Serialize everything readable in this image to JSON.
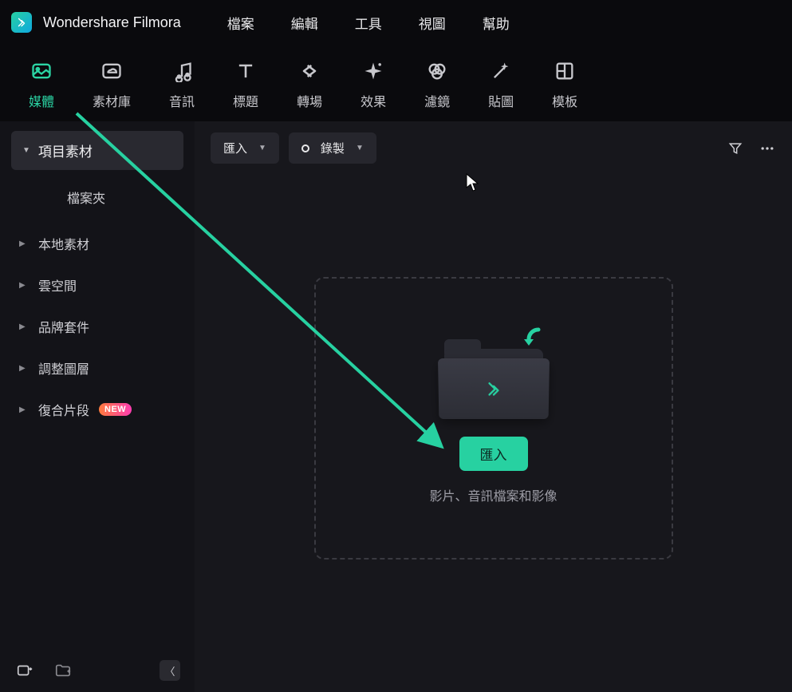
{
  "app": {
    "title": "Wondershare Filmora"
  },
  "menubar": {
    "items": [
      "檔案",
      "編輯",
      "工具",
      "視圖",
      "幫助"
    ]
  },
  "ribbon": {
    "items": [
      {
        "label": "媒體",
        "icon": "media",
        "active": true
      },
      {
        "label": "素材庫",
        "icon": "stock",
        "active": false
      },
      {
        "label": "音訊",
        "icon": "audio",
        "active": false
      },
      {
        "label": "標題",
        "icon": "titles",
        "active": false
      },
      {
        "label": "轉場",
        "icon": "transition",
        "active": false
      },
      {
        "label": "效果",
        "icon": "effects",
        "active": false
      },
      {
        "label": "濾鏡",
        "icon": "filters",
        "active": false
      },
      {
        "label": "貼圖",
        "icon": "stickers",
        "active": false
      },
      {
        "label": "模板",
        "icon": "templates",
        "active": false
      }
    ]
  },
  "sidebar": {
    "header": "項目素材",
    "sub": "檔案夾",
    "items": [
      {
        "label": "本地素材",
        "badge": null
      },
      {
        "label": "雲空間",
        "badge": null
      },
      {
        "label": "品牌套件",
        "badge": null
      },
      {
        "label": "調整圖層",
        "badge": null
      },
      {
        "label": "復合片段",
        "badge": "NEW"
      }
    ]
  },
  "main_toolbar": {
    "import": "匯入",
    "record": "錄製"
  },
  "dropzone": {
    "button": "匯入",
    "hint": "影片、音訊檔案和影像"
  },
  "colors": {
    "accent": "#27d1a1"
  }
}
